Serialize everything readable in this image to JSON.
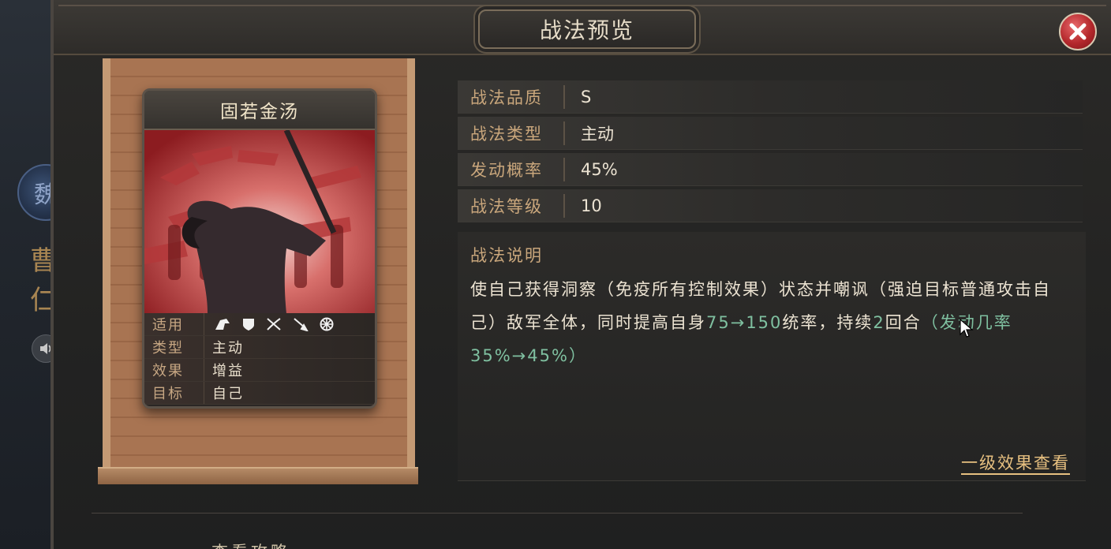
{
  "background": {
    "faction_badge": "魏",
    "hero_name": "曹仁"
  },
  "window": {
    "title": "战法预览"
  },
  "card": {
    "name": "固若金汤",
    "rows": [
      {
        "key": "适用",
        "value": ""
      },
      {
        "key": "类型",
        "value": "主动"
      },
      {
        "key": "效果",
        "value": "增益"
      },
      {
        "key": "目标",
        "value": "自己"
      }
    ],
    "applicable_units": [
      "cavalry-icon",
      "shield-icon",
      "archer-icon",
      "spear-icon",
      "siege-icon"
    ]
  },
  "stats": [
    {
      "key": "战法品质",
      "value": "S"
    },
    {
      "key": "战法类型",
      "value": "主动"
    },
    {
      "key": "发动概率",
      "value": "45%"
    },
    {
      "key": "战法等级",
      "value": "10"
    }
  ],
  "description": {
    "title": "战法说明",
    "part1": "使自己获得洞察（免疫所有控制效果）状态并嘲讽（强迫目标普通攻击自己）敌军全体，同时提高自身",
    "hl1": "75→150",
    "part2": "统率，持续",
    "hl2": "2",
    "part3": "回合",
    "hl3": "（发动几率35%→45%）",
    "link": "一级效果查看"
  },
  "footer": {
    "partial_text": "查看攻略"
  },
  "colors": {
    "highlight": "#7fc0a0",
    "label": "#caa77c",
    "close": "#b4282c"
  }
}
